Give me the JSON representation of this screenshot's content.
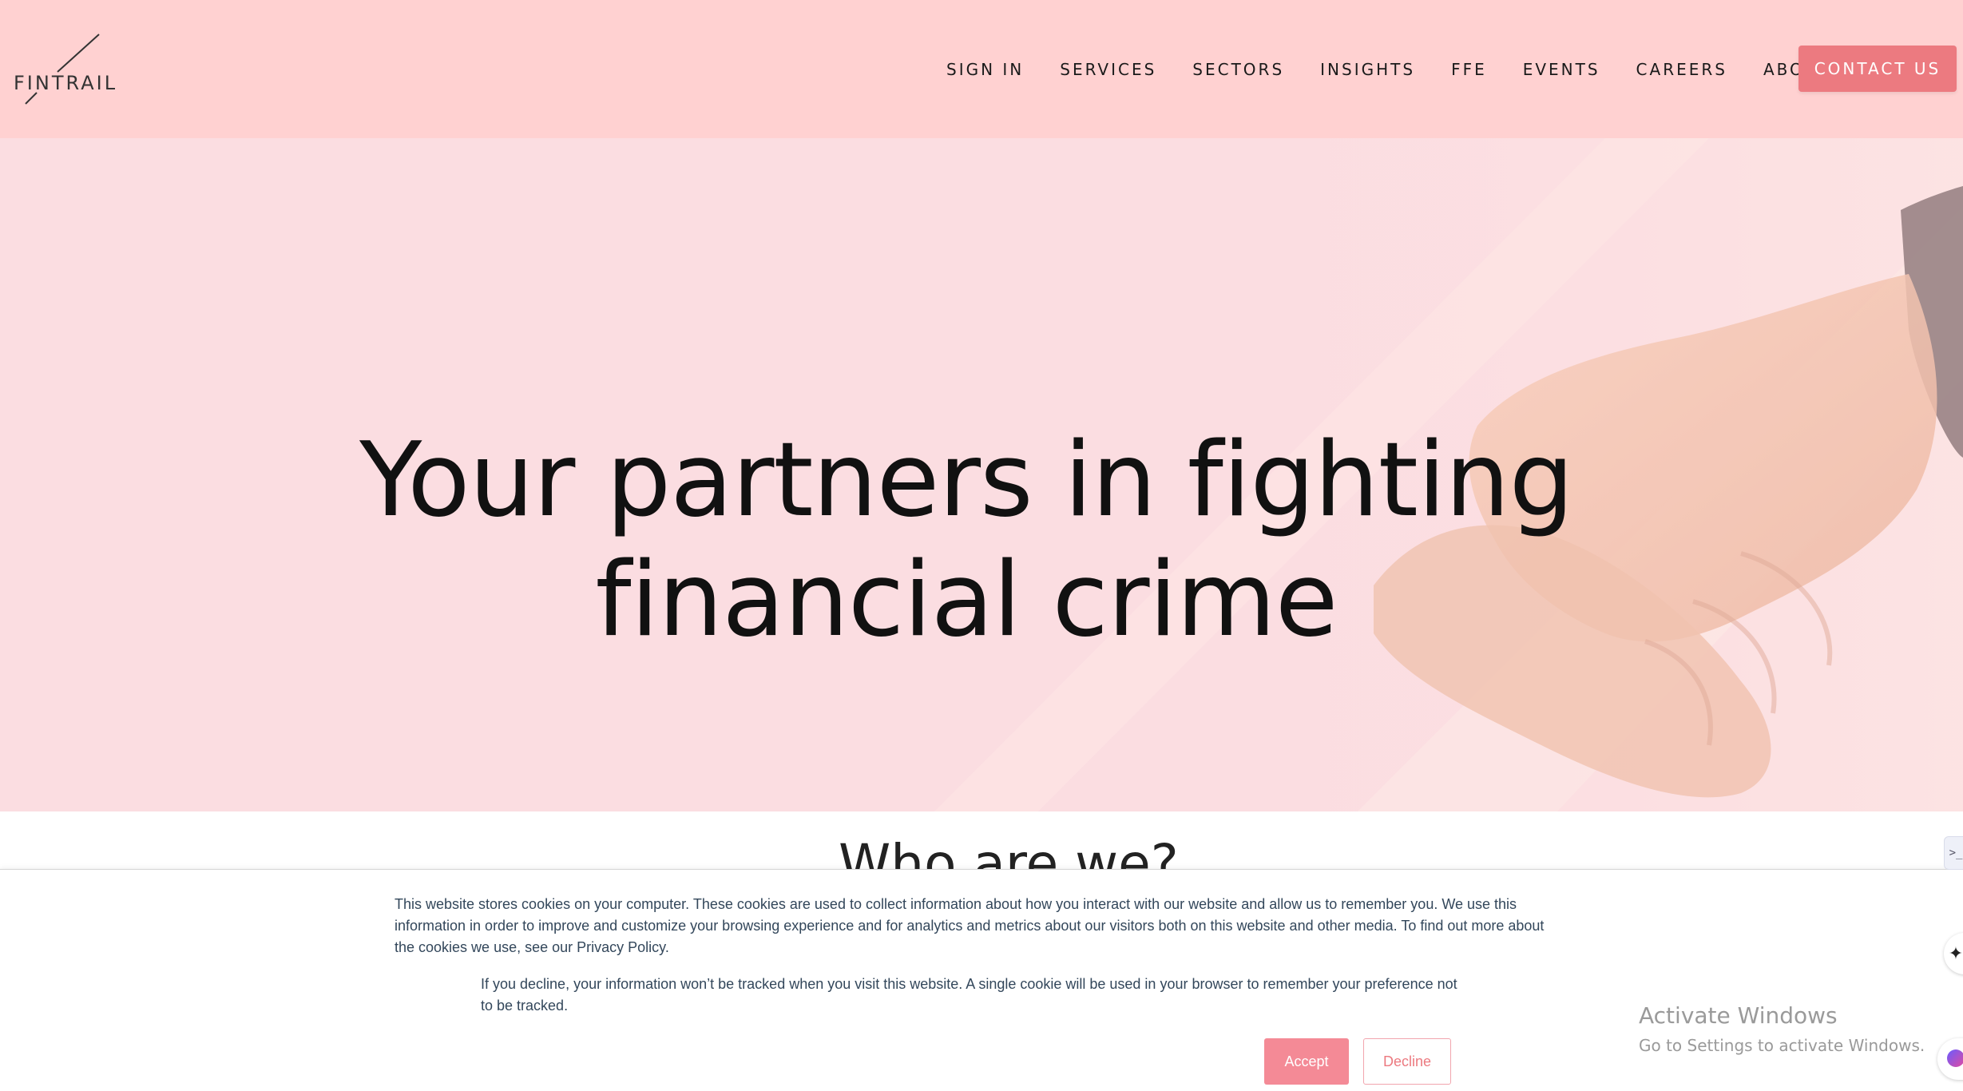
{
  "header": {
    "logo_text": "FINTRAIL",
    "nav": [
      "SIGN IN",
      "SERVICES",
      "SECTORS",
      "INSIGHTS",
      "FFE",
      "EVENTS",
      "CAREERS",
      "ABOUT"
    ],
    "contact_label": "CONTACT US"
  },
  "hero": {
    "title_line1": "Your partners in fighting",
    "title_line2": "financial crime",
    "background_image": "handshake-photo"
  },
  "section": {
    "heading": "Who are we?"
  },
  "cookie_banner": {
    "text1": "This website stores cookies on your computer. These cookies are used to collect information about how you interact with our website and allow us to remember you. We use this information in order to improve and customize your browsing experience and for analytics and metrics about our visitors both on this website and other media. To find out more about the cookies we use, see our Privacy Policy.",
    "text2": "If you decline, your information won’t be tracked when you visit this website. A single cookie will be used in your browser to remember your preference not to be tracked.",
    "accept_label": "Accept",
    "decline_label": "Decline"
  },
  "os_watermark": {
    "title": "Activate Windows",
    "subtitle": "Go to Settings to activate Windows."
  },
  "colors": {
    "header_bg": "#ffd1d1",
    "hero_bg": "#fbdde1",
    "accent": "#ec7a80",
    "accept_bg": "#f48a96",
    "cookie_text": "#33475b"
  },
  "icons": {
    "logo_mark": "diagonal-slash",
    "edge_widget": "chevron-code-icon",
    "edge_star": "sparkle-icon",
    "edge_chat": "chat-bubble-icon"
  }
}
